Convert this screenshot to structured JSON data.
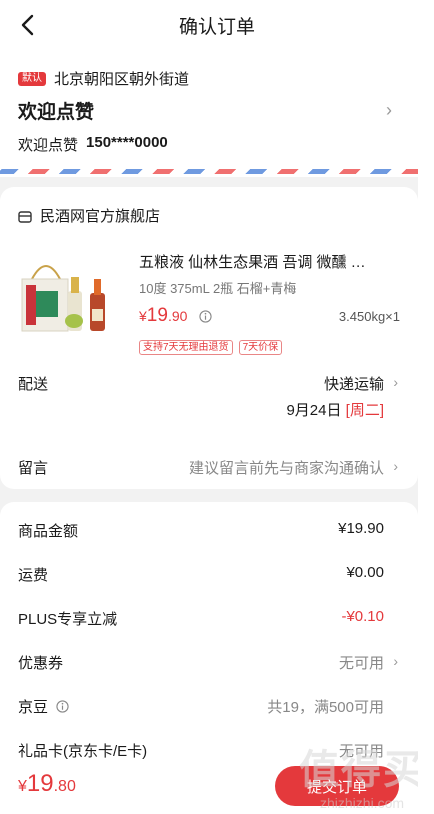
{
  "header": {
    "title": "确认订单"
  },
  "address": {
    "tag": "默认",
    "region": "北京朝阳区朝外街道",
    "name": "欢迎点赞",
    "contact_name": "欢迎点赞",
    "phone": "150****0000"
  },
  "shop": {
    "name": "民酒网官方旗舰店",
    "icon": "store-icon"
  },
  "product": {
    "title": "五粮液 仙林生态果酒 吾调 微醺 …",
    "spec": "10度 375mL 2瓶 石榴+青梅",
    "price_symbol": "¥",
    "price_int": "19",
    "price_dec": ".90",
    "weight_qty": "3.450kg×1",
    "badges": [
      "支持7天无理由退货",
      "7天价保"
    ]
  },
  "delivery": {
    "label": "配送",
    "method": "快递运输",
    "date": "9月24日",
    "weekday": "[周二]"
  },
  "message": {
    "label": "留言",
    "placeholder": "建议留言前先与商家沟通确认"
  },
  "summary": {
    "goods_amount_label": "商品金额",
    "goods_amount": "¥19.90",
    "freight_label": "运费",
    "freight": "¥0.00",
    "plus_label": "PLUS专享立减",
    "plus_discount": "-¥0.10",
    "coupon_label": "优惠券",
    "coupon_value": "无可用",
    "jingdou_label": "京豆",
    "jingdou_value": "共19，满500可用",
    "giftcard_label": "礼品卡(京东卡/E卡)",
    "giftcard_value": "无可用"
  },
  "bottom": {
    "total_symbol": "¥",
    "total_int": "19",
    "total_dec": ".80",
    "submit_label": "提交订单"
  },
  "watermark": {
    "big": "值得买",
    "small": "zhizhizhi.com"
  },
  "colors": {
    "accent": "#e4393c",
    "background": "#f2f2f2"
  }
}
